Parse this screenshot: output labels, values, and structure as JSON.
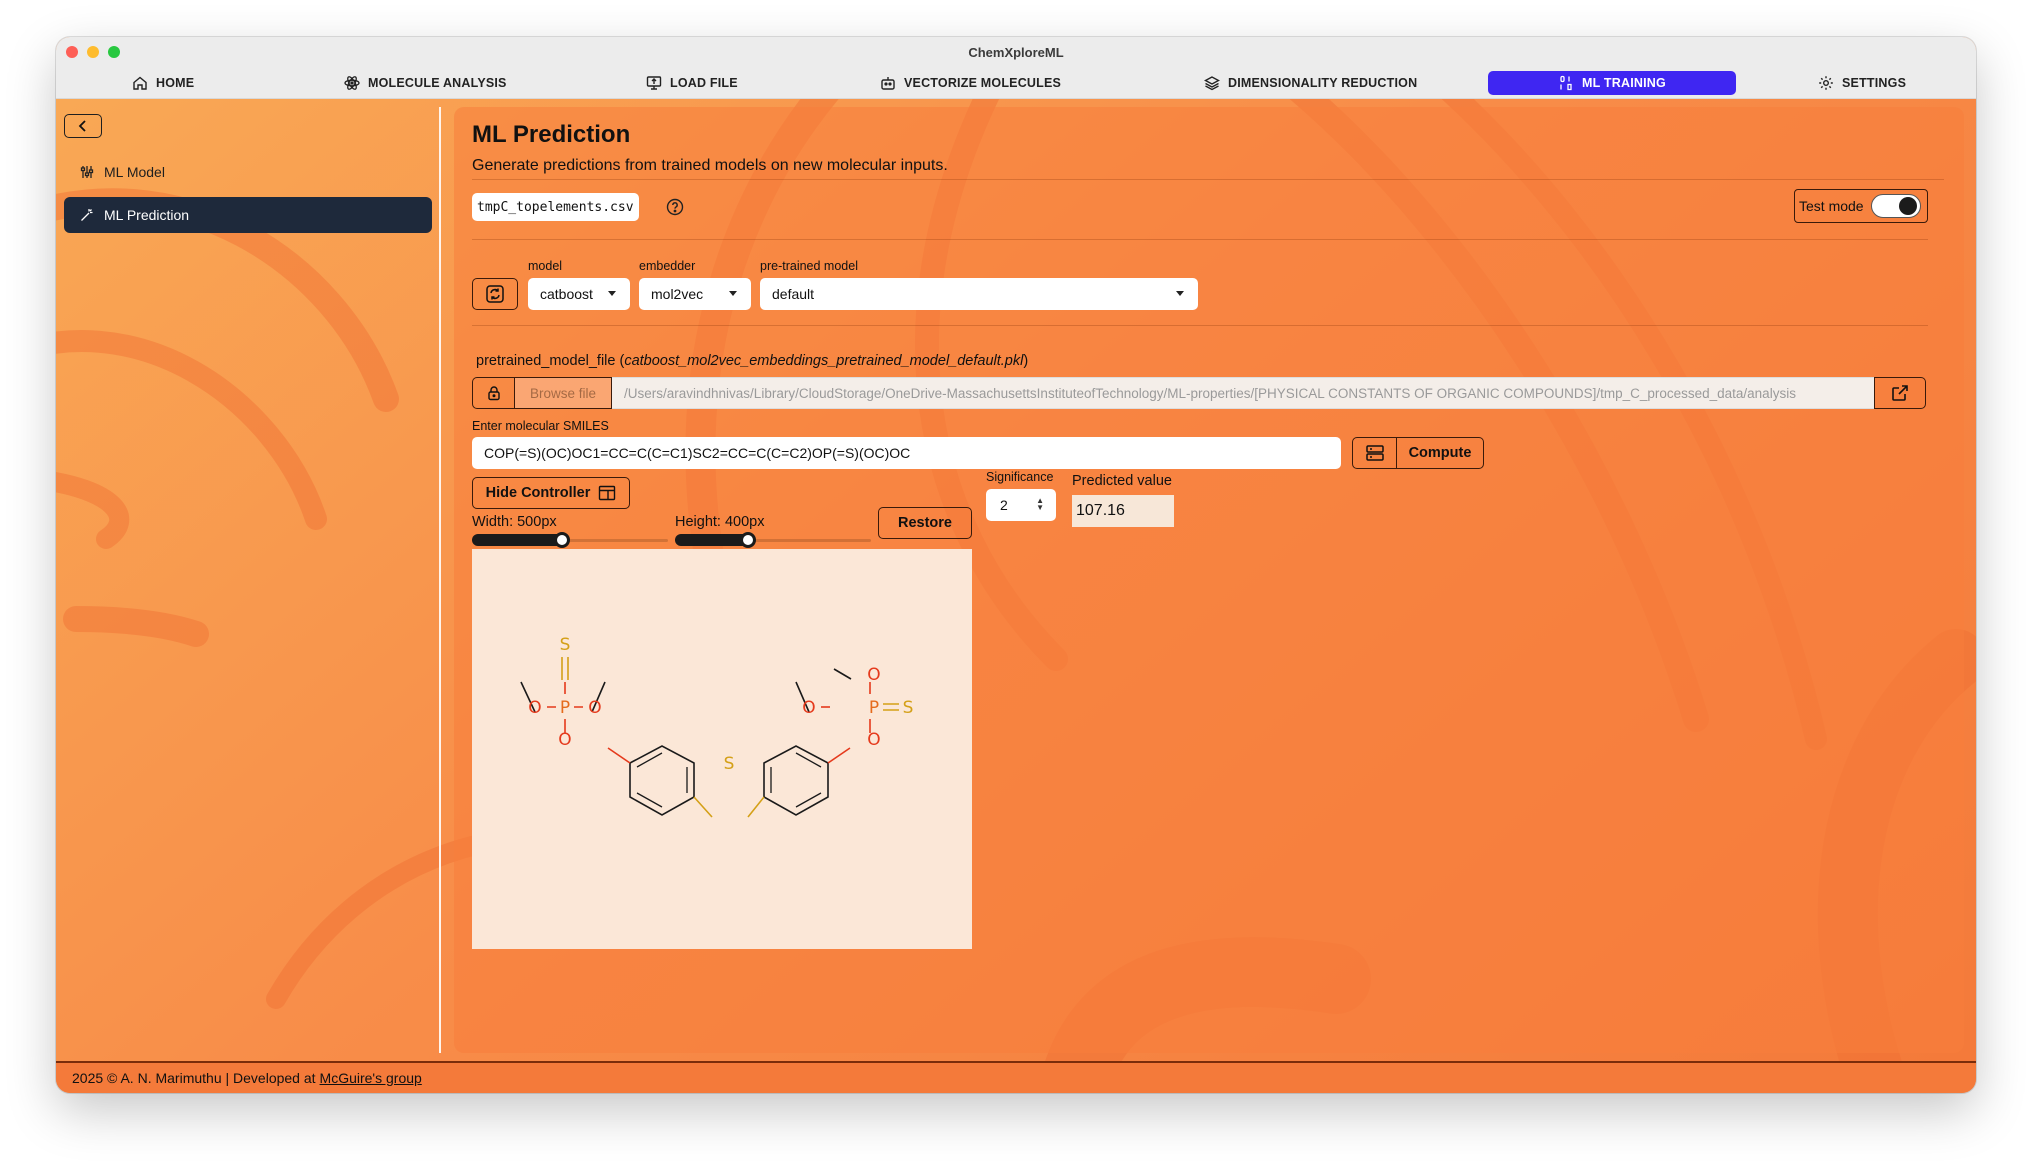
{
  "window": {
    "title": "ChemXploreML"
  },
  "nav": {
    "items": [
      {
        "label": "HOME",
        "icon": "home-icon"
      },
      {
        "label": "MOLECULE ANALYSIS",
        "icon": "atom-icon"
      },
      {
        "label": "LOAD FILE",
        "icon": "monitor-upload-icon"
      },
      {
        "label": "VECTORIZE MOLECULES",
        "icon": "robot-icon"
      },
      {
        "label": "DIMENSIONALITY REDUCTION",
        "icon": "layers-icon"
      },
      {
        "label": "ML TRAINING",
        "icon": "binary-icon",
        "active": true
      },
      {
        "label": "SETTINGS",
        "icon": "gear-icon"
      }
    ],
    "active_color": "#3f26f2"
  },
  "sidebar": {
    "items": [
      {
        "label": "ML Model",
        "icon": "sliders-icon"
      },
      {
        "label": "ML Prediction",
        "icon": "wand-icon",
        "active": true
      }
    ]
  },
  "main": {
    "title": "ML Prediction",
    "subtitle": "Generate predictions from trained models on new molecular inputs.",
    "file_chip": "tmpC_topelements.csv",
    "test_mode_label": "Test mode",
    "test_mode_on": true,
    "model_label": "model",
    "model_value": "catboost",
    "embedder_label": "embedder",
    "embedder_value": "mol2vec",
    "pretrained_label": "pre-trained model",
    "pretrained_value": "default",
    "pkl_label_prefix": "pretrained_model_file (",
    "pkl_filename": "catboost_mol2vec_embeddings_pretrained_model_default.pkl",
    "pkl_label_suffix": ")",
    "browse_label": "Browse file",
    "path_value": "/Users/aravindhnivas/Library/CloudStorage/OneDrive-MassachusettsInstituteofTechnology/ML-properties/[PHYSICAL CONSTANTS OF ORGANIC COMPOUNDS]/tmp_C_processed_data/analysis",
    "smiles_label": "Enter molecular SMILES",
    "smiles_value": "COP(=S)(OC)OC1=CC=C(C=C1)SC2=CC=C(C=C2)OP(=S)(OC)OC",
    "compute_label": "Compute",
    "hide_controller_label": "Hide Controller",
    "width_label": "Width: 500px",
    "height_label": "Height: 400px",
    "width_fraction": 0.45,
    "height_fraction": 0.36,
    "restore_label": "Restore",
    "significance_label": "Significance",
    "significance_value": "2",
    "predicted_label": "Predicted value",
    "predicted_value": "107.16"
  },
  "molecule": {
    "atoms": [
      "S",
      "O",
      "P",
      "O",
      "O",
      "S",
      "O",
      "O",
      "P",
      "S",
      "O"
    ],
    "colors": {
      "oxygen": "#e53a1c",
      "sulfur": "#d4a017",
      "phosphorus": "#e56b1c",
      "bond": "#1a1a1a"
    }
  },
  "footer": {
    "text": "2025 © A. N. Marimuthu | Developed at",
    "link": "McGuire's group"
  }
}
